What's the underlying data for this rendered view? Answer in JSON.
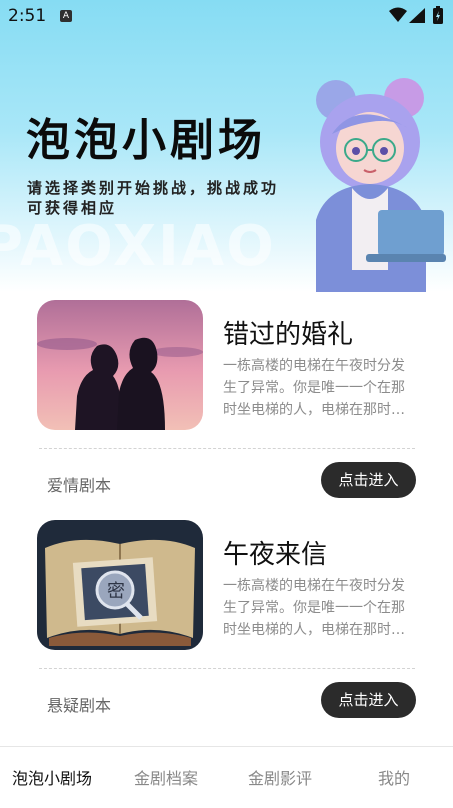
{
  "status_bar": {
    "time": "2:51",
    "sim_label": "A"
  },
  "hero": {
    "title": "泡泡小剧场",
    "subtitle": "请选择类别开始挑战，挑战成功 可获得相应",
    "watermark": "PAOXIAO"
  },
  "cards": [
    {
      "title": "错过的婚礼",
      "description": "一栋高楼的电梯在午夜时分发生了异常。你是唯一一个在那时坐电梯的人，电梯在那时坐电梯的人",
      "genre": "爱情剧本",
      "button_label": "点击进入",
      "image": "couple-sunset-image"
    },
    {
      "title": "午夜来信",
      "description": "一栋高楼的电梯在午夜时分发生了异常。你是唯一一个在那时坐电梯的人，电梯在那时坐电梯的人",
      "genre": "悬疑剧本",
      "button_label": "点击进入",
      "image": "mystery-book-image"
    }
  ],
  "bottom_nav": {
    "items": [
      {
        "label": "泡泡小剧场",
        "active": true
      },
      {
        "label": "金剧档案",
        "active": false
      },
      {
        "label": "金剧影评",
        "active": false
      },
      {
        "label": "我的",
        "active": false
      }
    ]
  },
  "colors": {
    "hero_gradient_top": "#86dcf3",
    "button_bg": "#2b2b2b",
    "muted_text": "#8c8c8c"
  }
}
